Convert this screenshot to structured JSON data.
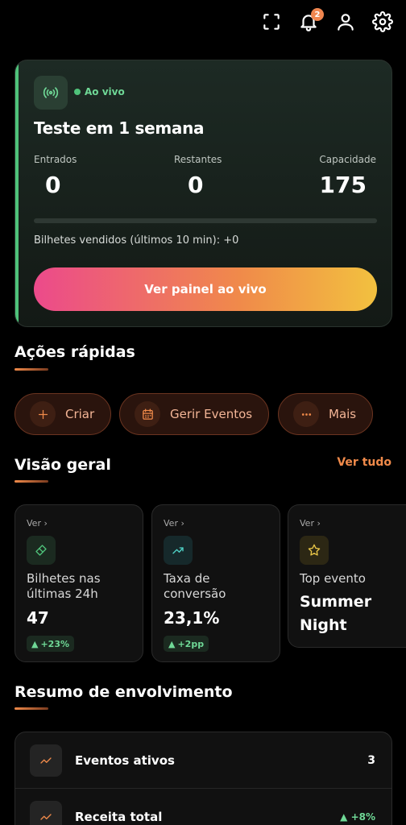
{
  "topbar": {
    "notification_count": "2"
  },
  "live": {
    "status": "Ao vivo",
    "title": "Teste em 1 semana",
    "stats": [
      {
        "label": "Entrados",
        "value": "0"
      },
      {
        "label": "Restantes",
        "value": "0"
      },
      {
        "label": "Capacidade",
        "value": "175"
      }
    ],
    "progress": 0,
    "sold_text": "Bilhetes vendidos (últimos 10 min): +0",
    "button_label": "Ver painel ao vivo"
  },
  "quick_actions": {
    "title": "Ações rápidas",
    "items": [
      {
        "label": "Criar",
        "icon": "plus-icon"
      },
      {
        "label": "Gerir Eventos",
        "icon": "calendar-icon"
      },
      {
        "label": "Mais",
        "icon": "more-icon"
      }
    ]
  },
  "overview": {
    "title": "Visão geral",
    "see_all": "Ver tudo",
    "cards": [
      {
        "ver": "Ver ›",
        "label": "Bilhetes nas últimas 24h",
        "value": "47",
        "delta": "+23%",
        "icon": "ticket-icon",
        "color": "#4fc27a"
      },
      {
        "ver": "Ver ›",
        "label": "Taxa de conversão",
        "value": "23,1%",
        "delta": "+2pp",
        "icon": "trend-icon",
        "color": "#4fd1c5"
      },
      {
        "ver": "Ver ›",
        "label": "Top evento",
        "value": "Summer Night",
        "icon": "star-icon",
        "color": "#e8c547"
      }
    ]
  },
  "engagement": {
    "title": "Resumo de envolvimento",
    "rows": [
      {
        "label": "Eventos ativos",
        "value": "3"
      },
      {
        "label": "Receita total",
        "value": "+8%"
      }
    ]
  }
}
